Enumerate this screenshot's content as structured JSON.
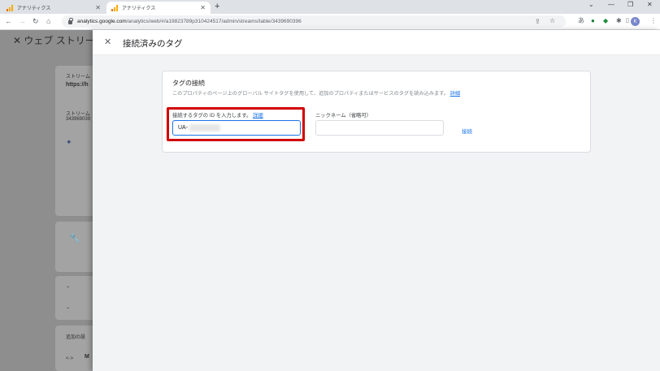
{
  "browser": {
    "tabs": [
      {
        "title": "アナリティクス",
        "active": false
      },
      {
        "title": "アナリティクス",
        "active": true
      }
    ],
    "new_tab_label": "+",
    "url_host": "analytics.google.com",
    "url_path": "/analytics/web/#/a19823789p310424517/admin/streams/table/3439690396",
    "profile_initial": "K"
  },
  "background_page": {
    "title": "ウェブ ストリー",
    "stream_name_label": "ストリーム",
    "stream_url": "https://h",
    "stream_id_label": "ストリーム",
    "stream_id": "343969039",
    "additional_settings": "追加の設",
    "item_m": "M"
  },
  "panel": {
    "title": "接続済みのタグ",
    "card_title": "タグの接続",
    "card_description": "このプロパティのページ上のグローバル サイトタグを使用して、追加のプロパティまたはサービスのタグを読み込みます。",
    "detail_link": "詳細",
    "id_label": "接続するタグの ID を入力します。",
    "id_value": "UA-",
    "nickname_label": "ニックネーム（省略可）",
    "nickname_value": "",
    "connect_label": "接続"
  },
  "colors": {
    "accent": "#1a73e8",
    "highlight_border": "#d10000",
    "overlay": "#8e8e8e"
  }
}
